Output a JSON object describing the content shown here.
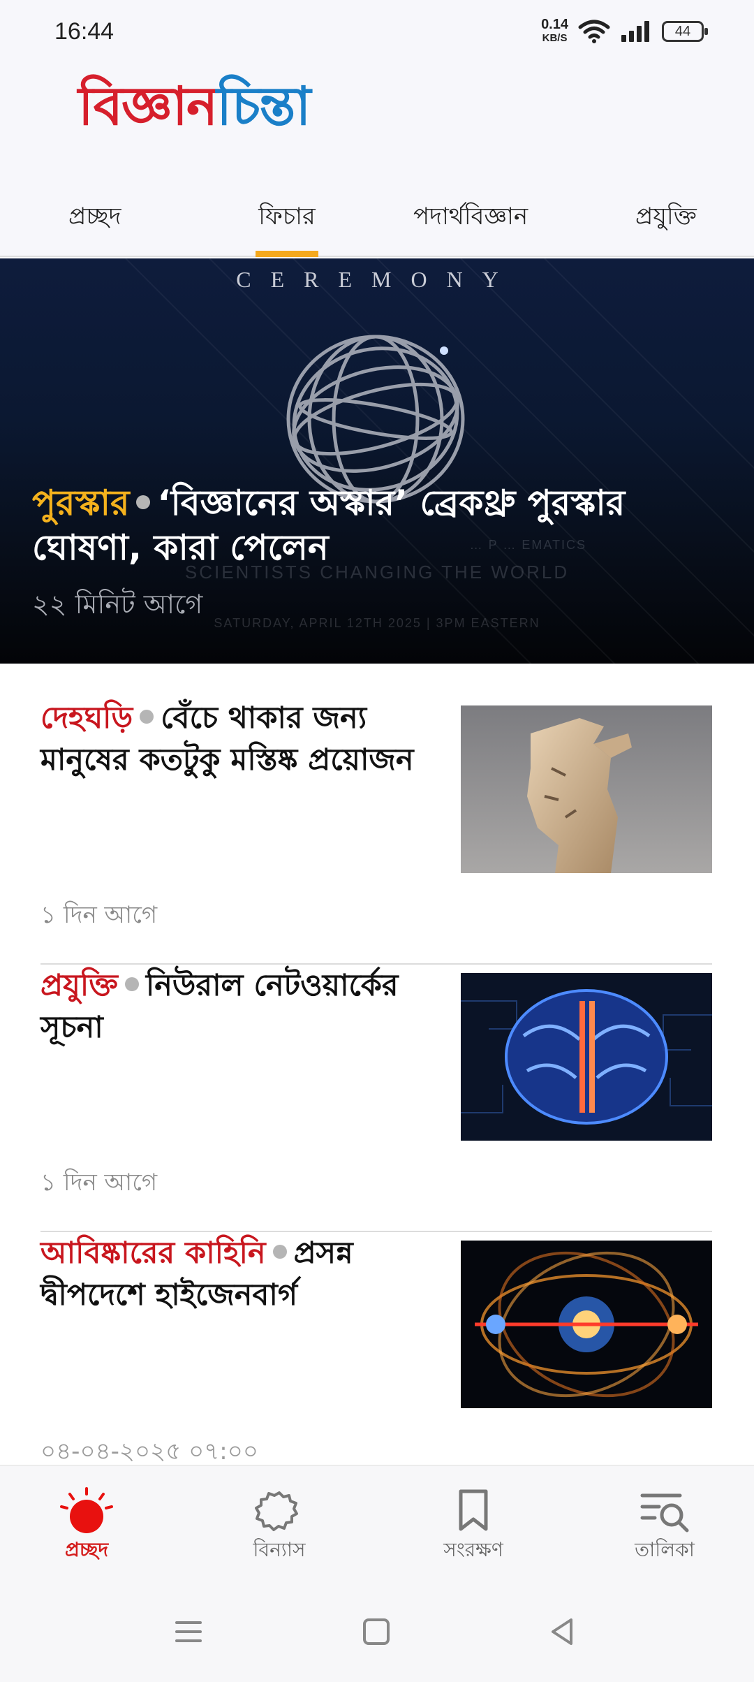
{
  "status_bar": {
    "time": "16:44",
    "net_speed_value": "0.14",
    "net_speed_unit": "KB/S",
    "battery": "44",
    "icons": [
      "wifi-icon",
      "signal-icon",
      "battery-icon"
    ]
  },
  "header": {
    "logo_part1": "বিজ্ঞান",
    "logo_part2": "চিন্তা"
  },
  "tabs": [
    {
      "label": "প্রচ্ছদ",
      "active": false
    },
    {
      "label": "ফিচার",
      "active": true
    },
    {
      "label": "পদার্থবিজ্ঞান",
      "active": false
    },
    {
      "label": "প্রযুক্তি",
      "active": false
    }
  ],
  "hero": {
    "image_text_top": "CEREMONY",
    "image_text_line1": "… P … EMATICS",
    "image_text_line2": "SCIENTISTS CHANGING THE WORLD",
    "image_text_line3": "SATURDAY, APRIL 12TH 2025 | 3PM EASTERN",
    "category": "পুরস্কার",
    "title": "‘বিজ্ঞানের অস্কার’ ব্রেকথ্রু পুরস্কার ঘোষণা, কারা পেলেন",
    "time": "২২ মিনিট আগে"
  },
  "articles": [
    {
      "category": "দেহঘড়ি",
      "title": "বেঁচে থাকার জন্য মানুষের কতটুকু মস্তিষ্ক প্রয়োজন",
      "time": "১ দিন আগে"
    },
    {
      "category": "প্রযুক্তি",
      "title": "নিউরাল নেটওয়ার্কের সূচনা",
      "time": "১ দিন আগে"
    },
    {
      "category": "আবিষ্কারের কাহিনি",
      "title": "প্রসন্ন দ্বীপদেশে হাইজেনবার্গ",
      "time": "০৪-০৪-২০২৫ ০৭:০০"
    }
  ],
  "bottom_nav": [
    {
      "label": "প্রচ্ছদ",
      "icon": "sun-icon",
      "active": true
    },
    {
      "label": "বিন্যাস",
      "icon": "gear-icon",
      "active": false
    },
    {
      "label": "সংরক্ষণ",
      "icon": "bookmark-icon",
      "active": false
    },
    {
      "label": "তালিকা",
      "icon": "list-search-icon",
      "active": false
    }
  ],
  "colors": {
    "brand_red": "#d61f2c",
    "brand_blue": "#1a7fc8",
    "tab_indicator": "#f4a81d",
    "hero_category": "#f5b21d",
    "article_category": "#c8161e"
  }
}
